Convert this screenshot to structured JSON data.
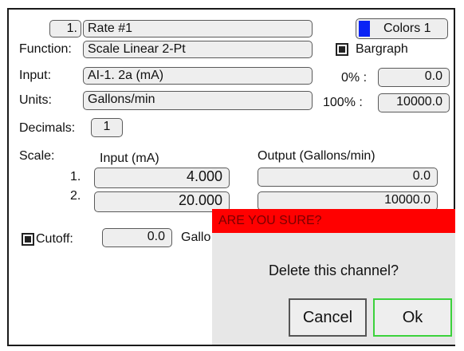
{
  "channel": {
    "number": "1.",
    "name": "Rate #1"
  },
  "colors_button": {
    "label": "Colors 1",
    "swatch_color": "#0a23f5"
  },
  "function": {
    "label": "Function:",
    "value": "Scale Linear 2-Pt"
  },
  "input": {
    "label": "Input:",
    "value": "AI-1. 2a (mA)"
  },
  "units": {
    "label": "Units:",
    "value": "Gallons/min"
  },
  "bargraph": {
    "label": "Bargraph",
    "checked": true,
    "zero_label": "0% :",
    "zero_value": "0.0",
    "full_label": "100% :",
    "full_value": "10000.0"
  },
  "decimals": {
    "label": "Decimals:",
    "value": "1"
  },
  "scale": {
    "label": "Scale:",
    "input_header": "Input (mA)",
    "output_header": "Output (Gallons/min)",
    "rows": [
      {
        "index": "1.",
        "input": "4.000",
        "output": "0.0"
      },
      {
        "index": "2.",
        "input": "20.000",
        "output": "10000.0"
      }
    ]
  },
  "cutoff": {
    "label": "Cutoff:",
    "checked": true,
    "value": "0.0",
    "units_partial": "Gallo"
  },
  "dialog": {
    "title": "ARE YOU SURE?",
    "title_color": "#ff0000",
    "message": "Delete this channel?",
    "cancel_label": "Cancel",
    "ok_label": "Ok",
    "ok_border_color": "#3cd23c"
  }
}
